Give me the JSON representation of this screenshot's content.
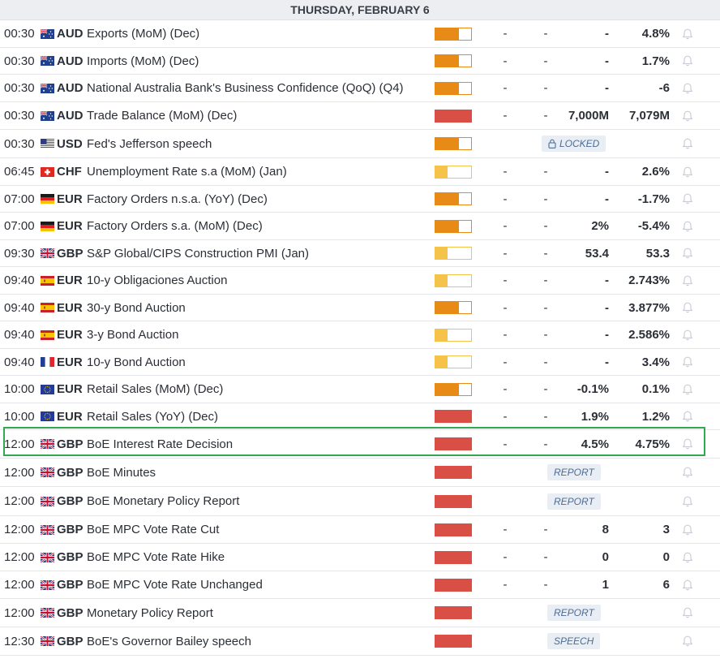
{
  "header": {
    "date": "THURSDAY, FEBRUARY 6"
  },
  "colors": {
    "low": "#f5c24a",
    "medium": "#e88b16",
    "high": "#d94f45",
    "highlight": "#32a852"
  },
  "rows": [
    {
      "time": "00:30",
      "flag": "au",
      "currency": "AUD",
      "event": "Exports (MoM) (Dec)",
      "impact": "medium",
      "col1": "-",
      "col2": "-",
      "previous": "-",
      "actual": "4.8%"
    },
    {
      "time": "00:30",
      "flag": "au",
      "currency": "AUD",
      "event": "Imports (MoM) (Dec)",
      "impact": "medium",
      "col1": "-",
      "col2": "-",
      "previous": "-",
      "actual": "1.7%"
    },
    {
      "time": "00:30",
      "flag": "au",
      "currency": "AUD",
      "event": "National Australia Bank's Business Confidence (QoQ) (Q4)",
      "impact": "medium",
      "col1": "-",
      "col2": "-",
      "previous": "-",
      "actual": "-6"
    },
    {
      "time": "00:30",
      "flag": "au",
      "currency": "AUD",
      "event": "Trade Balance (MoM) (Dec)",
      "impact": "high",
      "col1": "-",
      "col2": "-",
      "previous": "7,000M",
      "actual": "7,079M"
    },
    {
      "time": "00:30",
      "flag": "us",
      "currency": "USD",
      "event": "Fed's Jefferson speech",
      "impact": "medium",
      "badge": "LOCKED",
      "badge_type": "locked"
    },
    {
      "time": "06:45",
      "flag": "ch",
      "currency": "CHF",
      "event": "Unemployment Rate s.a (MoM) (Jan)",
      "impact": "low",
      "col1": "-",
      "col2": "-",
      "previous": "-",
      "actual": "2.6%"
    },
    {
      "time": "07:00",
      "flag": "de",
      "currency": "EUR",
      "event": "Factory Orders n.s.a. (YoY) (Dec)",
      "impact": "medium",
      "col1": "-",
      "col2": "-",
      "previous": "-",
      "actual": "-1.7%"
    },
    {
      "time": "07:00",
      "flag": "de",
      "currency": "EUR",
      "event": "Factory Orders s.a. (MoM) (Dec)",
      "impact": "medium",
      "col1": "-",
      "col2": "-",
      "previous": "2%",
      "actual": "-5.4%"
    },
    {
      "time": "09:30",
      "flag": "gb",
      "currency": "GBP",
      "event": "S&P Global/CIPS Construction PMI (Jan)",
      "impact": "low",
      "col1": "-",
      "col2": "-",
      "previous": "53.4",
      "actual": "53.3"
    },
    {
      "time": "09:40",
      "flag": "es",
      "currency": "EUR",
      "event": "10-y Obligaciones Auction",
      "impact": "low",
      "col1": "-",
      "col2": "-",
      "previous": "-",
      "actual": "2.743%"
    },
    {
      "time": "09:40",
      "flag": "es",
      "currency": "EUR",
      "event": "30-y Bond Auction",
      "impact": "medium",
      "col1": "-",
      "col2": "-",
      "previous": "-",
      "actual": "3.877%"
    },
    {
      "time": "09:40",
      "flag": "es",
      "currency": "EUR",
      "event": "3-y Bond Auction",
      "impact": "low",
      "col1": "-",
      "col2": "-",
      "previous": "-",
      "actual": "2.586%"
    },
    {
      "time": "09:40",
      "flag": "fr",
      "currency": "EUR",
      "event": "10-y Bond Auction",
      "impact": "low",
      "col1": "-",
      "col2": "-",
      "previous": "-",
      "actual": "3.4%"
    },
    {
      "time": "10:00",
      "flag": "eu",
      "currency": "EUR",
      "event": "Retail Sales (MoM) (Dec)",
      "impact": "medium",
      "col1": "-",
      "col2": "-",
      "previous": "-0.1%",
      "actual": "0.1%"
    },
    {
      "time": "10:00",
      "flag": "eu",
      "currency": "EUR",
      "event": "Retail Sales (YoY) (Dec)",
      "impact": "high",
      "col1": "-",
      "col2": "-",
      "previous": "1.9%",
      "actual": "1.2%"
    },
    {
      "time": "12:00",
      "flag": "gb",
      "currency": "GBP",
      "event": "BoE Interest Rate Decision",
      "impact": "high",
      "col1": "-",
      "col2": "-",
      "previous": "4.5%",
      "actual": "4.75%",
      "highlighted": true
    },
    {
      "time": "12:00",
      "flag": "gb",
      "currency": "GBP",
      "event": "BoE Minutes",
      "impact": "high",
      "badge": "REPORT",
      "badge_type": "report"
    },
    {
      "time": "12:00",
      "flag": "gb",
      "currency": "GBP",
      "event": "BoE Monetary Policy Report",
      "impact": "high",
      "badge": "REPORT",
      "badge_type": "report"
    },
    {
      "time": "12:00",
      "flag": "gb",
      "currency": "GBP",
      "event": "BoE MPC Vote Rate Cut",
      "impact": "high",
      "col1": "-",
      "col2": "-",
      "previous": "8",
      "actual": "3"
    },
    {
      "time": "12:00",
      "flag": "gb",
      "currency": "GBP",
      "event": "BoE MPC Vote Rate Hike",
      "impact": "high",
      "col1": "-",
      "col2": "-",
      "previous": "0",
      "actual": "0"
    },
    {
      "time": "12:00",
      "flag": "gb",
      "currency": "GBP",
      "event": "BoE MPC Vote Rate Unchanged",
      "impact": "high",
      "col1": "-",
      "col2": "-",
      "previous": "1",
      "actual": "6"
    },
    {
      "time": "12:00",
      "flag": "gb",
      "currency": "GBP",
      "event": "Monetary Policy Report",
      "impact": "high",
      "badge": "REPORT",
      "badge_type": "report"
    },
    {
      "time": "12:30",
      "flag": "gb",
      "currency": "GBP",
      "event": "BoE's Governor Bailey speech",
      "impact": "high",
      "badge": "SPEECH",
      "badge_type": "report"
    }
  ]
}
